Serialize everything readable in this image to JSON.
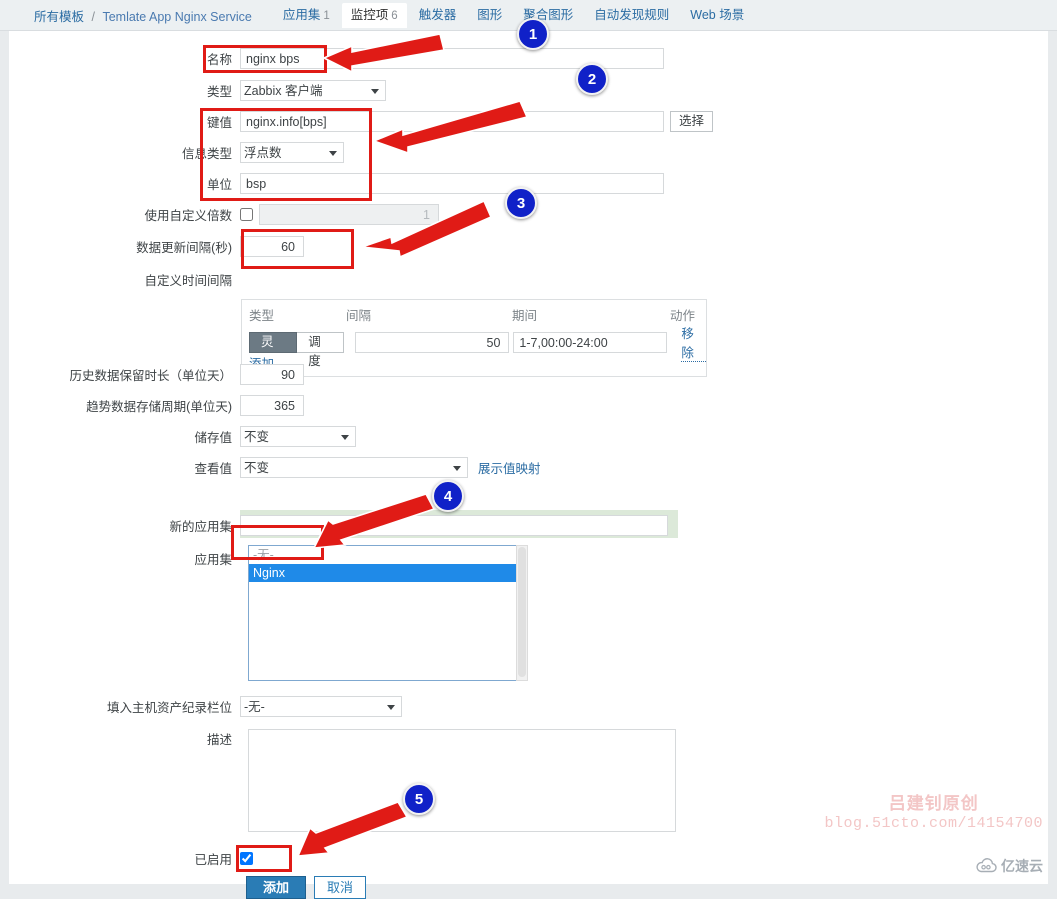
{
  "breadcrumb": {
    "root": "所有模板",
    "separator": "/",
    "current": "Temlate App Nginx Service"
  },
  "tabs": [
    {
      "label": "应用集",
      "count": "1",
      "active": false
    },
    {
      "label": "监控项",
      "count": "6",
      "active": true
    },
    {
      "label": "触发器",
      "count": "",
      "active": false
    },
    {
      "label": "图形",
      "count": "",
      "active": false
    },
    {
      "label": "聚合图形",
      "count": "",
      "active": false
    },
    {
      "label": "自动发现规则",
      "count": "",
      "active": false
    },
    {
      "label": "Web 场景",
      "count": "",
      "active": false
    }
  ],
  "form": {
    "name": {
      "label": "名称",
      "value": "nginx bps"
    },
    "type": {
      "label": "类型",
      "value": "Zabbix 客户端"
    },
    "key": {
      "label": "键值",
      "value": "nginx.info[bps]",
      "select_button": "选择"
    },
    "value_type": {
      "label": "信息类型",
      "value": "浮点数"
    },
    "units": {
      "label": "单位",
      "value": "bsp"
    },
    "custom_multiplier": {
      "label": "使用自定义倍数",
      "checked": false,
      "value": "1"
    },
    "update_interval": {
      "label": "数据更新间隔(秒)",
      "value": "60"
    },
    "custom_intervals": {
      "label": "自定义时间间隔",
      "headers": {
        "type": "类型",
        "interval": "间隔",
        "period": "期间",
        "action": "动作"
      },
      "rows": [
        {
          "type_options": [
            "灵活",
            "调度"
          ],
          "type_selected": "灵活",
          "interval": "50",
          "period": "1-7,00:00-24:00",
          "action": "移除"
        }
      ],
      "add_label": "添加"
    },
    "history": {
      "label": "历史数据保留时长（单位天）",
      "value": "90"
    },
    "trends": {
      "label": "趋势数据存储周期(单位天)",
      "value": "365"
    },
    "store_value": {
      "label": "储存值",
      "value": "不变"
    },
    "show_value": {
      "label": "查看值",
      "value": "不变",
      "link": "展示值映射"
    },
    "new_application": {
      "label": "新的应用集",
      "value": "",
      "placeholder": ""
    },
    "applications": {
      "label": "应用集",
      "options": [
        {
          "label": "-无-",
          "selected": false,
          "muted": true
        },
        {
          "label": "Nginx",
          "selected": true,
          "muted": false
        }
      ]
    },
    "inventory_field": {
      "label": "填入主机资产纪录栏位",
      "value": "-无-"
    },
    "description": {
      "label": "描述",
      "value": ""
    },
    "enabled": {
      "label": "已启用",
      "checked": true
    }
  },
  "actions": {
    "submit": "添加",
    "cancel": "取消"
  },
  "annotations": {
    "badges": [
      {
        "number": "1"
      },
      {
        "number": "2"
      },
      {
        "number": "3"
      },
      {
        "number": "4"
      },
      {
        "number": "5"
      }
    ],
    "accent_color": "#e01b16",
    "badge_color": "#1021c8"
  },
  "watermark": {
    "line1": "吕建钊原创",
    "line2": "blog.51cto.com/14154700"
  },
  "brand": {
    "label": "亿速云"
  }
}
